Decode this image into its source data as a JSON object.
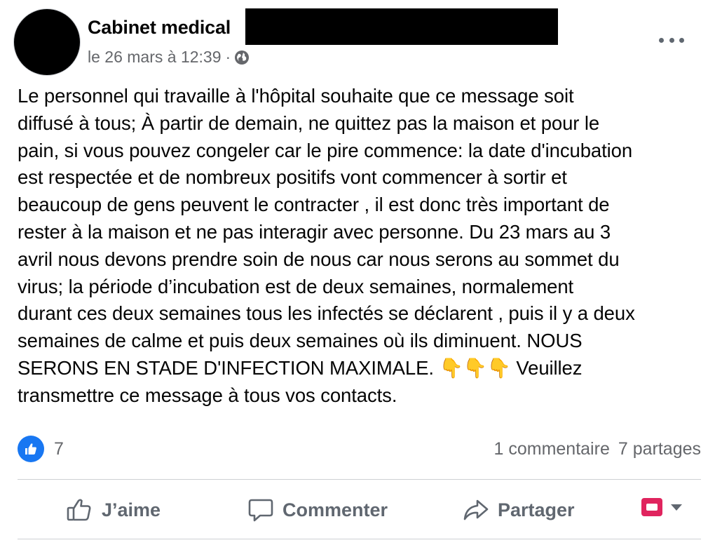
{
  "post": {
    "author": "Cabinet medical",
    "date": "le 26 mars à 12:39",
    "separator": "·",
    "privacy_icon": "globe-icon",
    "body": "Le personnel qui travaille à l'hôpital souhaite que ce message soit\ndiffusé à tous; À partir de demain, ne quittez pas la maison et pour le\npain, si vous pouvez congeler car le pire commence: la date d'incubation\nest respectée et de nombreux positifs vont commencer à sortir et\nbeaucoup de gens peuvent le contracter , il est donc très important de\nrester à la maison et ne pas interagir avec personne.  Du 23 mars au 3\navril nous devons prendre soin de nous car nous serons au sommet du\nvirus; la période d’incubation est de deux semaines, normalement\ndurant ces deux semaines tous les infectés se déclarent , puis il y a deux\nsemaines de calme et puis deux semaines où ils diminuent. NOUS\nSERONS EN STADE D'INFECTION MAXIMALE. 👇👇👇 Veuillez\ntransmettre ce message à tous vos contacts."
  },
  "reactions": {
    "icon": "like-icon",
    "count": "7",
    "comments": "1 commentaire",
    "shares": "7 partages"
  },
  "actions": {
    "like": "J’aime",
    "comment": "Commenter",
    "share": "Partager"
  },
  "colors": {
    "accent": "#1877f2",
    "secondary_text": "#65676b",
    "audience_flag": "#e0245e"
  }
}
